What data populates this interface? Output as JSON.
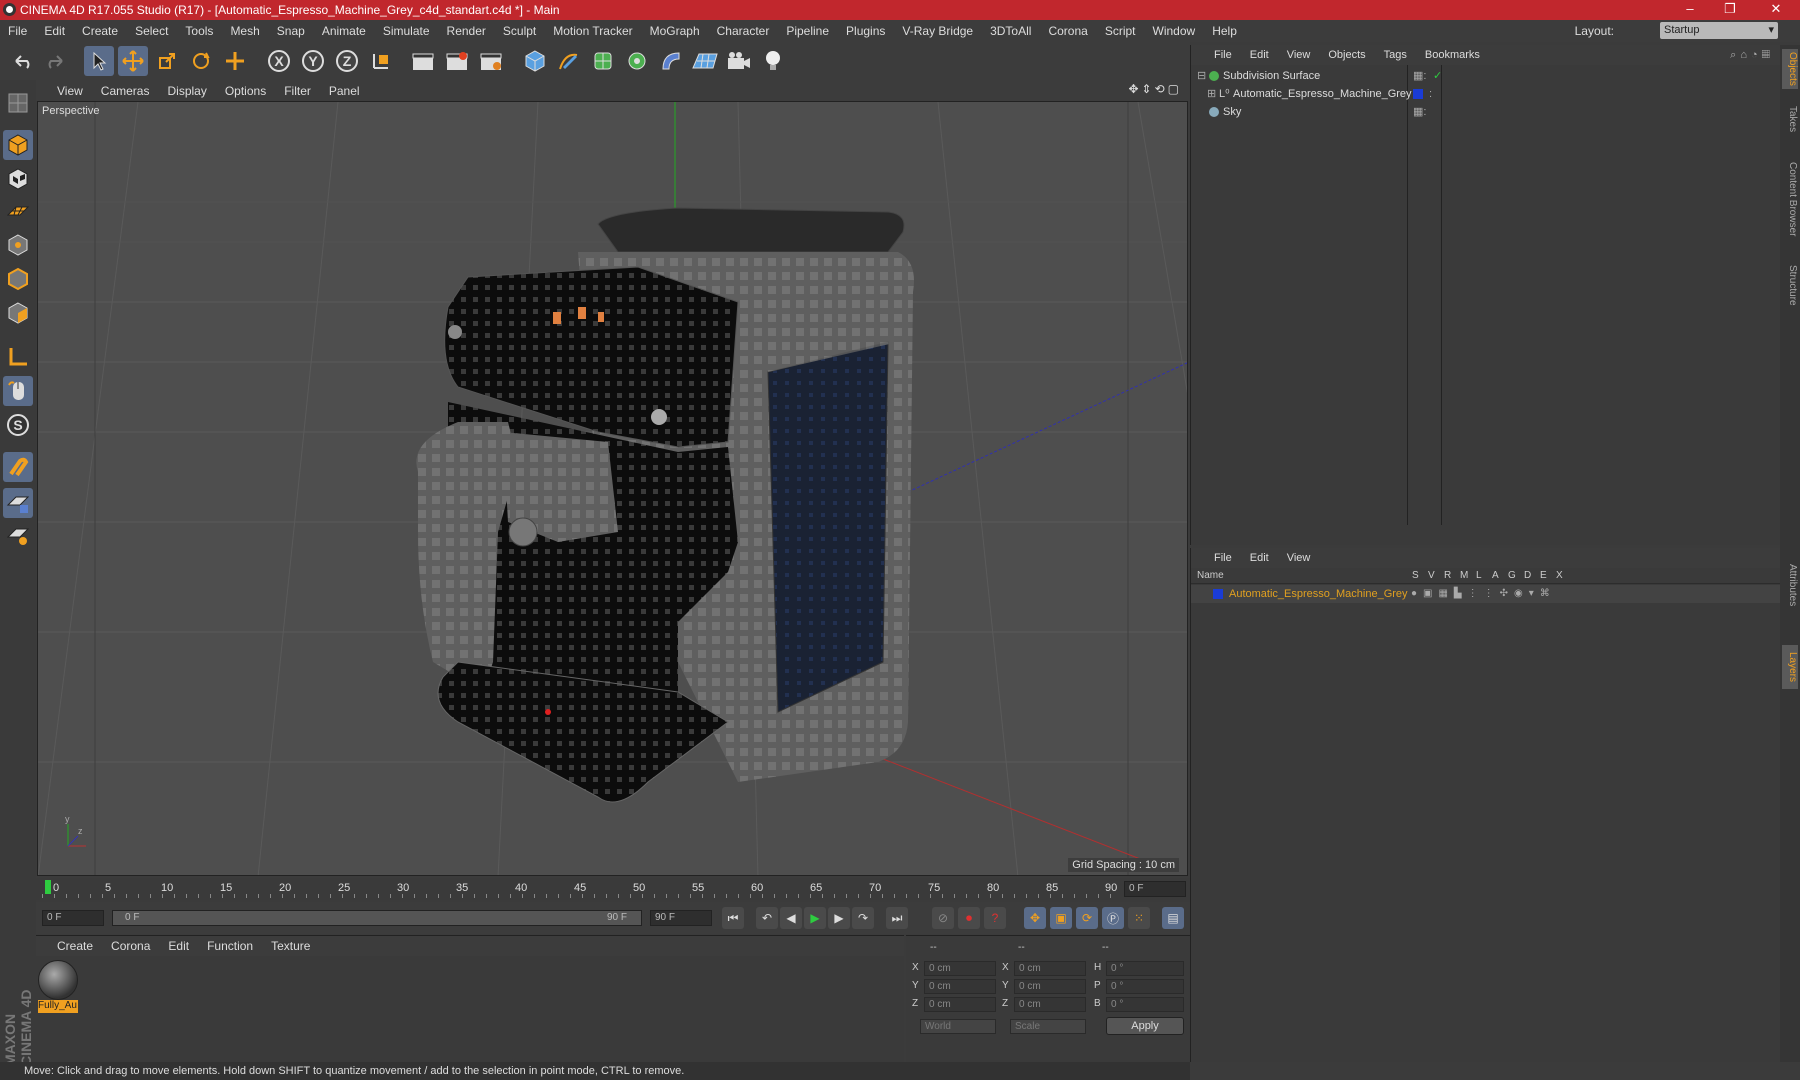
{
  "window": {
    "title": "CINEMA 4D R17.055 Studio (R17) - [Automatic_Espresso_Machine_Grey_c4d_standart.c4d *] - Main",
    "min": "–",
    "restore": "❐",
    "close": "✕"
  },
  "menu": [
    "File",
    "Edit",
    "Create",
    "Select",
    "Tools",
    "Mesh",
    "Snap",
    "Animate",
    "Simulate",
    "Render",
    "Sculpt",
    "Motion Tracker",
    "MoGraph",
    "Character",
    "Pipeline",
    "Plugins",
    "V-Ray Bridge",
    "3DToAll",
    "Corona",
    "Script",
    "Window",
    "Help"
  ],
  "layout": {
    "label": "Layout:",
    "value": "Startup"
  },
  "viewport": {
    "menu": [
      "View",
      "Cameras",
      "Display",
      "Options",
      "Filter",
      "Panel"
    ],
    "label": "Perspective",
    "grid_spacing": "Grid Spacing : 10 cm"
  },
  "timeline": {
    "ticks": [
      "0",
      "5",
      "10",
      "15",
      "20",
      "25",
      "30",
      "35",
      "40",
      "45",
      "50",
      "55",
      "60",
      "65",
      "70",
      "75",
      "80",
      "85",
      "90"
    ],
    "current_frame": "0 F"
  },
  "playbar": {
    "start": "0 F",
    "range_start": "0 F",
    "range_end": "90 F",
    "end": "90 F"
  },
  "material": {
    "menu": [
      "Create",
      "Corona",
      "Edit",
      "Function",
      "Texture"
    ],
    "item": "Fully_Au"
  },
  "coords": {
    "headers": [
      "--",
      "--",
      "--"
    ],
    "rows": [
      {
        "a": "X",
        "av": "0 cm",
        "b": "X",
        "bv": "0 cm",
        "c": "H",
        "cv": "0 °"
      },
      {
        "a": "Y",
        "av": "0 cm",
        "b": "Y",
        "bv": "0 cm",
        "c": "P",
        "cv": "0 °"
      },
      {
        "a": "Z",
        "av": "0 cm",
        "b": "Z",
        "bv": "0 cm",
        "c": "B",
        "cv": "0 °"
      }
    ],
    "world": "World",
    "scale": "Scale",
    "apply": "Apply"
  },
  "objects": {
    "menu": [
      "File",
      "Edit",
      "View",
      "Objects",
      "Tags",
      "Bookmarks"
    ],
    "items": [
      {
        "name": "Subdivision Surface",
        "color": "#4caf50"
      },
      {
        "name": "Automatic_Espresso_Machine_Grey",
        "color": "#9aa"
      },
      {
        "name": "Sky",
        "color": "#8ab"
      }
    ]
  },
  "layers": {
    "menu": [
      "File",
      "Edit",
      "View"
    ],
    "columns": [
      "Name",
      "S",
      "V",
      "R",
      "M",
      "L",
      "A",
      "G",
      "D",
      "E",
      "X"
    ],
    "item": "Automatic_Espresso_Machine_Grey",
    "item_color": "#e0a020",
    "swatch": "#1a3cd6"
  },
  "side_tabs": [
    "Objects",
    "Takes",
    "Content Browser",
    "Structure",
    "Attributes",
    "Layers"
  ],
  "status": "Move: Click and drag to move elements. Hold down SHIFT to quantize movement / add to the selection in point mode, CTRL to remove.",
  "brand": "MAXON CINEMA 4D"
}
